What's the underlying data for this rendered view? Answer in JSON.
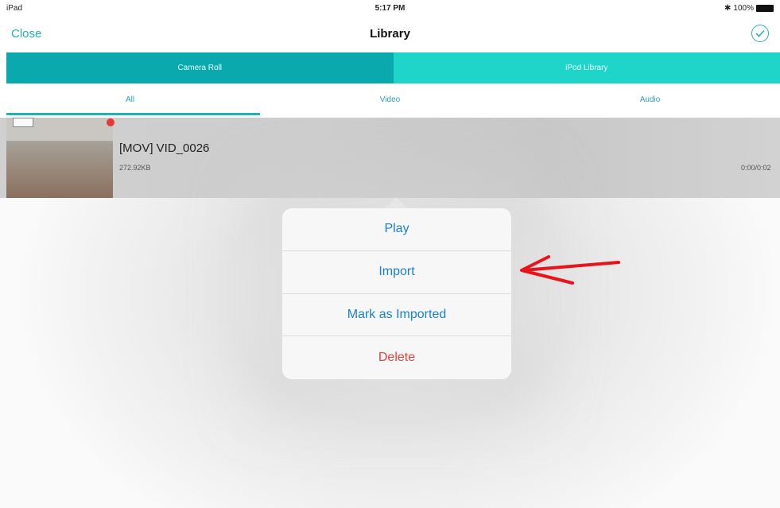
{
  "status_bar": {
    "device": "iPad",
    "time": "5:17 PM",
    "battery": "100%",
    "bluetooth_icon": "bluetooth-icon",
    "battery_icon": "battery-icon"
  },
  "nav": {
    "close_label": "Close",
    "title": "Library",
    "done_icon": "checkmark-circle-icon"
  },
  "source_tabs": [
    {
      "label": "Camera Roll"
    },
    {
      "label": "iPod Library"
    }
  ],
  "filter_tabs": [
    {
      "label": "All",
      "selected": true
    },
    {
      "label": "Video",
      "selected": false
    },
    {
      "label": "Audio",
      "selected": false
    }
  ],
  "media_items": [
    {
      "title": "[MOV] VID_0026",
      "size": "272.92KB",
      "duration": "0:00/0:02"
    }
  ],
  "popover": {
    "items": [
      {
        "label": "Play"
      },
      {
        "label": "Import"
      },
      {
        "label": "Mark as Imported"
      },
      {
        "label": "Delete"
      }
    ]
  },
  "colors": {
    "accent": "#1fb3b3",
    "tab_primary": "#0aa9ad",
    "tab_secondary": "#1fd4c9",
    "action_blue": "#1a7fd4",
    "destructive_red": "#e8403a",
    "annotation_red": "#e8141c"
  }
}
